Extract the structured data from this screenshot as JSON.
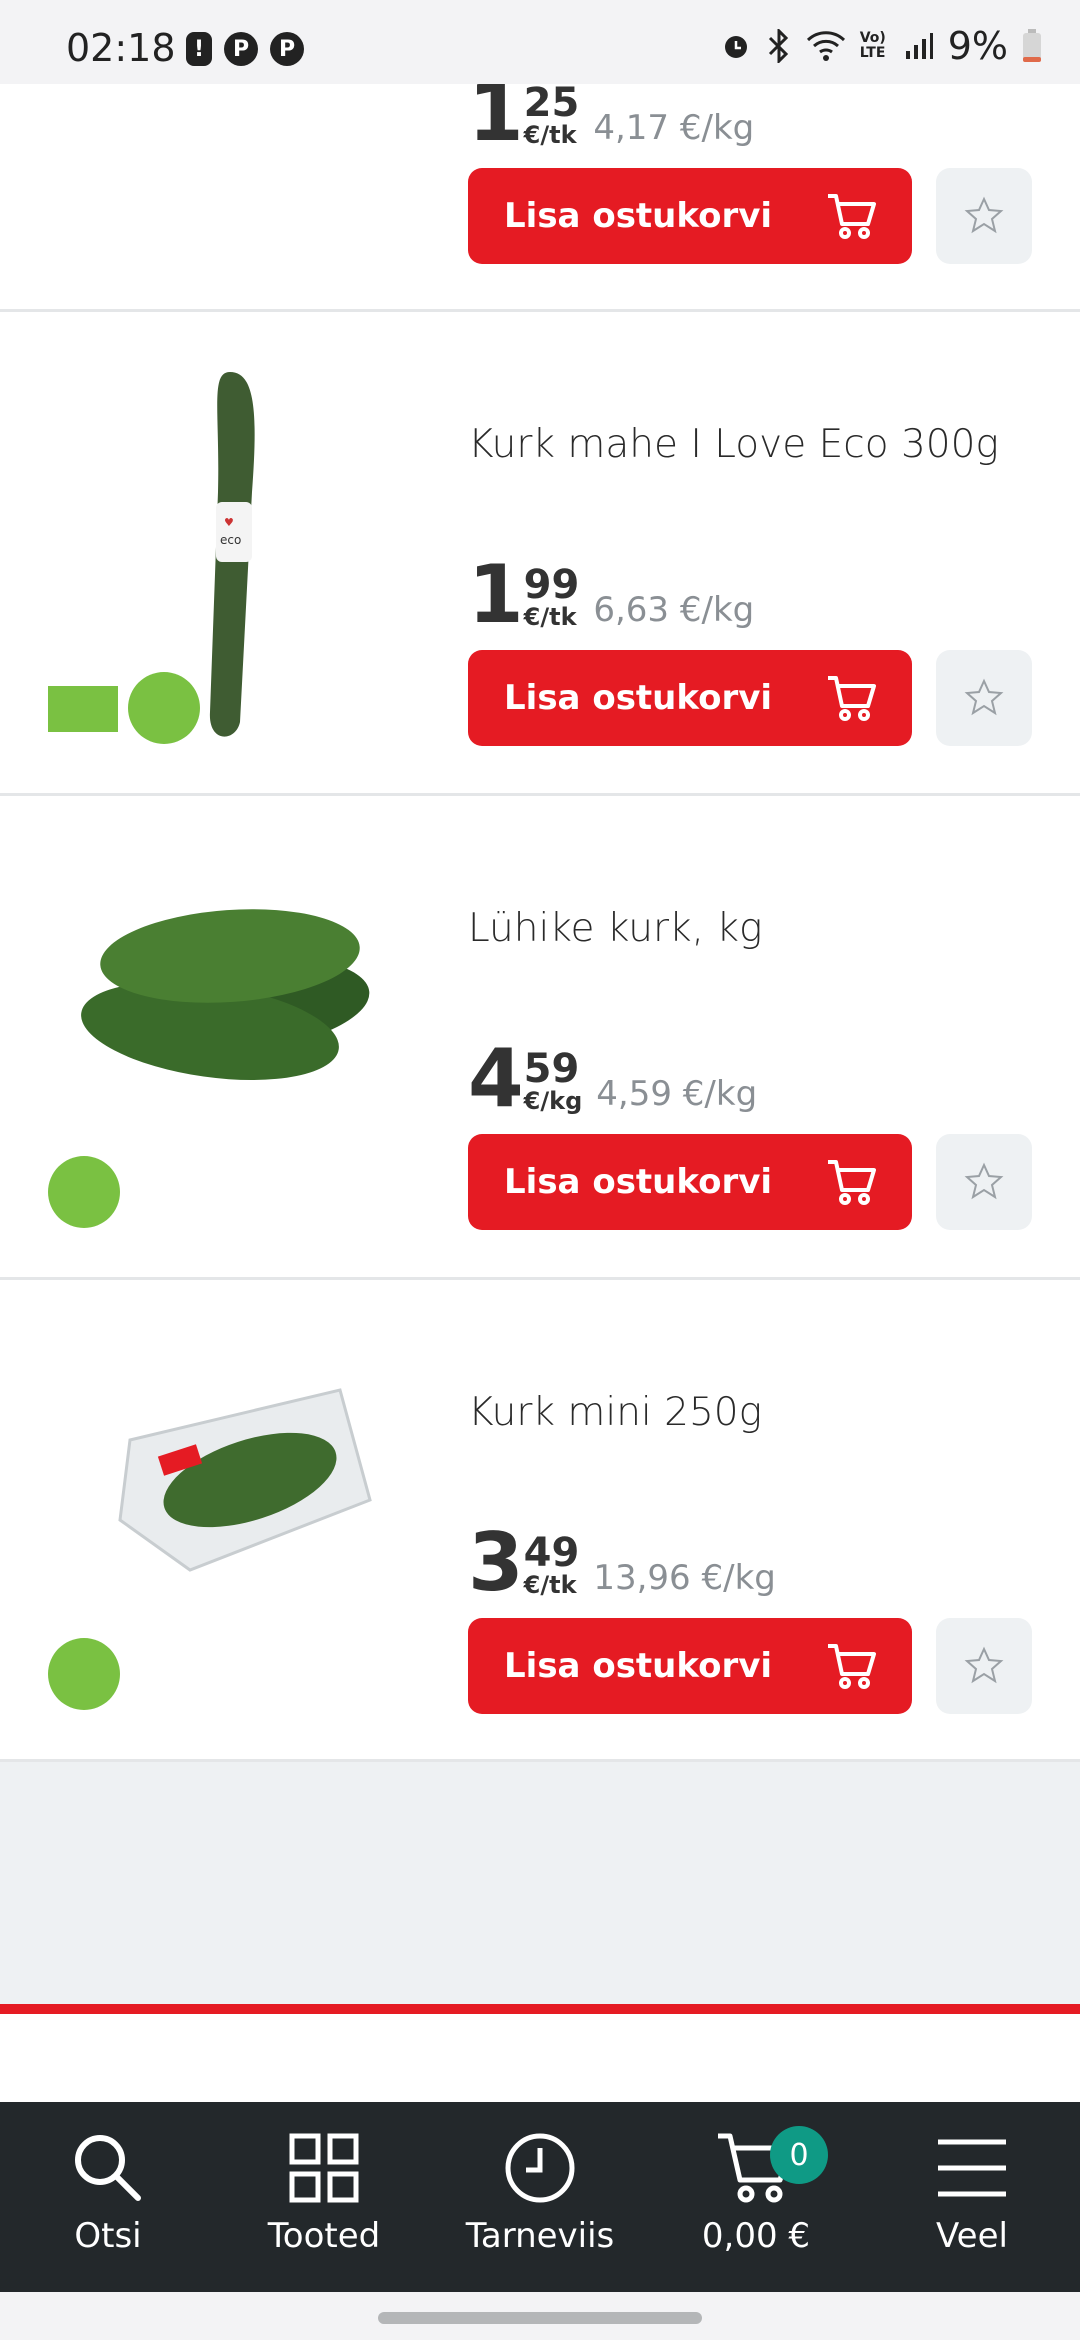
{
  "status_bar": {
    "time": "02:18",
    "battery": "9%",
    "network": "Vo) LTE",
    "icons": [
      "alert-icon",
      "pinterest-icon",
      "pinterest-icon",
      "alarm-icon",
      "bluetooth-icon",
      "wifi-icon",
      "signal-icon",
      "battery-icon"
    ]
  },
  "products": [
    {
      "name": "",
      "price_int": "1",
      "price_cents": "25",
      "unit": "€/tk",
      "per_kg": "4,17 €/kg",
      "button_label": "Lisa ostukorvi"
    },
    {
      "name": "Kurk mahe I Love Eco 300g",
      "price_int": "1",
      "price_cents": "99",
      "unit": "€/tk",
      "per_kg": "6,63 €/kg",
      "button_label": "Lisa ostukorvi"
    },
    {
      "name": "Lühike kurk, kg",
      "price_int": "4",
      "price_cents": "59",
      "unit": "€/kg",
      "per_kg": "4,59 €/kg",
      "button_label": "Lisa ostukorvi"
    },
    {
      "name": "Kurk mini 250g",
      "price_int": "3",
      "price_cents": "49",
      "unit": "€/tk",
      "per_kg": "13,96 €/kg",
      "button_label": "Lisa ostukorvi"
    }
  ],
  "nav": {
    "search": "Otsi",
    "products": "Tooted",
    "delivery": "Tarneviis",
    "cart_total": "0,00 €",
    "cart_count": "0",
    "more": "Veel"
  },
  "colors": {
    "accent": "#e51b23",
    "nav_bg": "#23282b",
    "badge": "#0f9a85"
  }
}
